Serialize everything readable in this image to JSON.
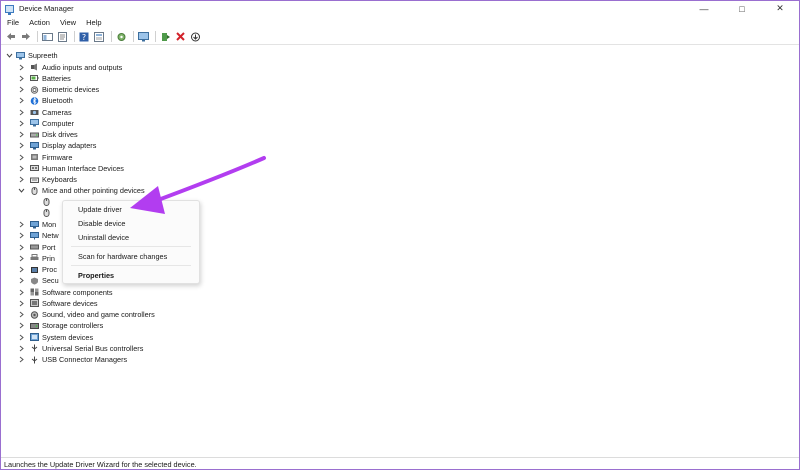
{
  "window": {
    "title": "Device Manager"
  },
  "menu": [
    "File",
    "Action",
    "View",
    "Help"
  ],
  "window_controls": {
    "minimize": "—",
    "maximize": "□",
    "close": "✕"
  },
  "tree": {
    "root": "Supreeth",
    "categories": [
      {
        "label": "Audio inputs and outputs",
        "icon": "speaker-icon"
      },
      {
        "label": "Batteries",
        "icon": "battery-icon"
      },
      {
        "label": "Biometric devices",
        "icon": "fingerprint-icon"
      },
      {
        "label": "Bluetooth",
        "icon": "bluetooth-icon"
      },
      {
        "label": "Cameras",
        "icon": "camera-icon"
      },
      {
        "label": "Computer",
        "icon": "computer-icon"
      },
      {
        "label": "Disk drives",
        "icon": "disk-icon"
      },
      {
        "label": "Display adapters",
        "icon": "display-icon"
      },
      {
        "label": "Firmware",
        "icon": "firmware-icon"
      },
      {
        "label": "Human Interface Devices",
        "icon": "hid-icon"
      },
      {
        "label": "Keyboards",
        "icon": "keyboard-icon"
      },
      {
        "label": "Mice and other pointing devices",
        "icon": "mouse-icon"
      },
      {
        "label": "",
        "icon": "mouse-icon"
      },
      {
        "label": "",
        "icon": "mouse-icon"
      },
      {
        "label": "Mon",
        "icon": "monitor-icon"
      },
      {
        "label": "Netw",
        "icon": "network-icon"
      },
      {
        "label": "Port",
        "icon": "port-icon"
      },
      {
        "label": "Prin",
        "icon": "printer-icon"
      },
      {
        "label": "Proc",
        "icon": "processor-icon"
      },
      {
        "label": "Secu",
        "icon": "security-icon"
      },
      {
        "label": "Software components",
        "icon": "software-component-icon"
      },
      {
        "label": "Software devices",
        "icon": "software-device-icon"
      },
      {
        "label": "Sound, video and game controllers",
        "icon": "sound-icon"
      },
      {
        "label": "Storage controllers",
        "icon": "storage-icon"
      },
      {
        "label": "System devices",
        "icon": "system-icon"
      },
      {
        "label": "Universal Serial Bus controllers",
        "icon": "usb-icon"
      },
      {
        "label": "USB Connector Managers",
        "icon": "usb-connector-icon"
      }
    ]
  },
  "context_menu": {
    "update": "Update driver",
    "disable": "Disable device",
    "uninstall": "Uninstall device",
    "scan": "Scan for hardware changes",
    "properties": "Properties"
  },
  "status": "Launches the Update Driver Wizard for the selected device.",
  "colors": {
    "accent": "#b23df0",
    "window_border": "#9a6fd0"
  }
}
